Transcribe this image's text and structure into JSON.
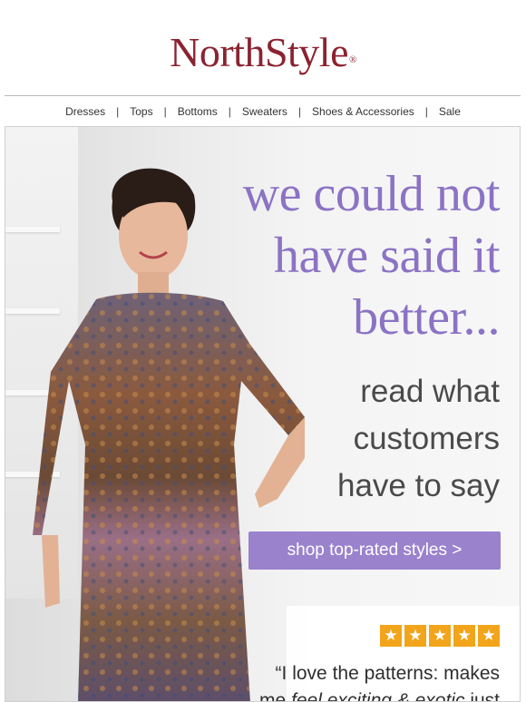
{
  "brand": {
    "name": "NorthStyle",
    "mark": "®",
    "color": "#8b2331"
  },
  "nav": [
    {
      "label": "Dresses"
    },
    {
      "label": "Tops"
    },
    {
      "label": "Bottoms"
    },
    {
      "label": "Sweaters"
    },
    {
      "label": "Shoes & Accessories"
    },
    {
      "label": "Sale"
    }
  ],
  "nav_separator": "|",
  "hero": {
    "headline": [
      "we could not",
      "have said it",
      "better..."
    ],
    "subline": [
      "read what",
      "customers",
      "have to say"
    ],
    "cta_label": "shop top-rated styles >",
    "accent_color": "#9a82cd"
  },
  "review": {
    "rating": 5,
    "rating_max": 5,
    "star_glyph": "★",
    "star_color": "#f2a51a",
    "quote_start": "“I love the patterns: makes",
    "quote_line2_prefix": "me ",
    "quote_line2_em": "feel exciting & exotic",
    "quote_line2_suffix": " just"
  }
}
